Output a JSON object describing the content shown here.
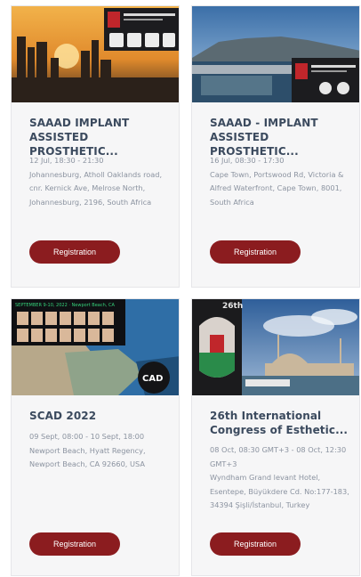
{
  "events": [
    {
      "title": "SAAAD IMPLANT ASSISTED PROSTHETIC...",
      "meta": [
        "12 Jul, 18:30 - 21:30",
        "Johannesburg, Atholl Oaklands road, cnr. Kernick Ave, Melrose North, Johannesburg, 2196, South Africa"
      ],
      "button": "Registration"
    },
    {
      "title": "SAAAD - IMPLANT ASSISTED PROSTHETIC...",
      "meta": [
        "16 Jul, 08:30 - 17:30",
        "Cape Town, Portswood Rd, Victoria & Alfred Waterfront, Cape Town, 8001, South Africa"
      ],
      "button": "Registration"
    },
    {
      "title": "SCAD 2022",
      "meta": [
        "09 Sept, 08:00 - 10 Sept, 18:00",
        "Newport Beach, Hyatt Regency, Newport Beach, CA 92660, USA"
      ],
      "button": "Registration"
    },
    {
      "title": "26th International Congress of Esthetic...",
      "meta": [
        "08 Oct, 08:30 GMT+3 - 08 Oct, 12:30 GMT+3",
        "Wyndham Grand levant Hotel, Esentepe, Büyükdere Cd. No:177-183, 34394 Şişli/İstanbul, Turkey"
      ],
      "button": "Registration"
    }
  ],
  "images": {
    "card3_banner": "SEPTEMBER 9-10, 2022 · Newport Beach, CA",
    "card3_logo": "CAD",
    "card4_badge": "26th"
  }
}
